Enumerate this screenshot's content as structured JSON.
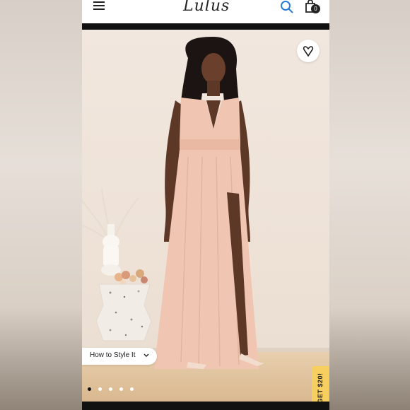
{
  "header": {
    "logo": "Lulus",
    "bag_count": "0"
  },
  "hero": {
    "style_button_label": "How to Style It",
    "promo_tab_label": "GET $20!",
    "carousel_dots": 5,
    "active_dot": 0
  },
  "colors": {
    "dress": "#f0c6b3",
    "promo": "#f6cf60",
    "search_icon": "#2a7bd5"
  },
  "icons": [
    "menu-icon",
    "search-icon",
    "shopping-bag-icon",
    "heart-icon",
    "chevron-down-icon"
  ]
}
